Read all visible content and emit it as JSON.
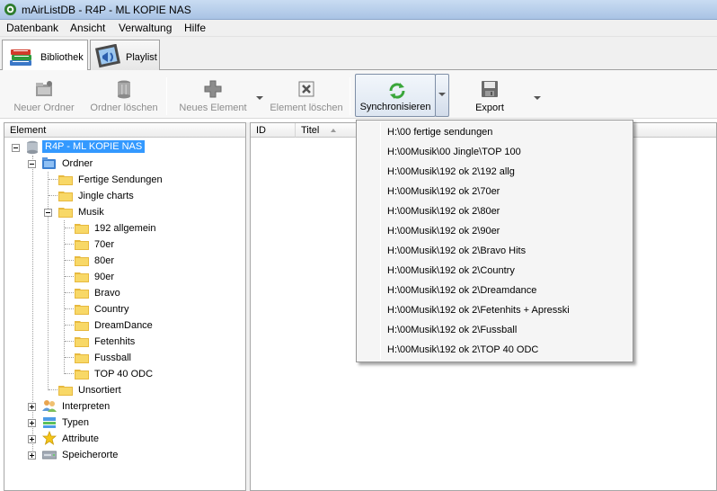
{
  "window": {
    "title": "mAirListDB - R4P - ML KOPIE NAS"
  },
  "menu": [
    "Datenbank",
    "Ansicht",
    "Verwaltung",
    "Hilfe"
  ],
  "tabs": [
    {
      "label": "Bibliothek",
      "active": true,
      "icon": "books-icon"
    },
    {
      "label": "Playlist",
      "active": false,
      "icon": "playlist-icon"
    }
  ],
  "toolbar": {
    "new_folder": "Neuer Ordner",
    "delete_folder": "Ordner löschen",
    "new_element": "Neues Element",
    "delete_element": "Element löschen",
    "sync": "Synchronisieren",
    "export": "Export"
  },
  "tree": {
    "header": "Element",
    "root": "R4P - ML KOPIE NAS",
    "ordner": "Ordner",
    "fertige": "Fertige Sendungen",
    "jingle": "Jingle charts",
    "musik": "Musik",
    "musik_children": [
      "192 allgemein",
      "70er",
      "80er",
      "90er",
      "Bravo",
      "Country",
      "DreamDance",
      "Fetenhits",
      "Fussball",
      "TOP 40 ODC"
    ],
    "unsortiert": "Unsortiert",
    "interpreten": "Interpreten",
    "typen": "Typen",
    "attribute": "Attribute",
    "speicherorte": "Speicherorte"
  },
  "list": {
    "columns": [
      "ID",
      "Titel"
    ]
  },
  "sync_menu": [
    "H:\\00 fertige sendungen",
    "H:\\00Musik\\00 Jingle\\TOP 100",
    "H:\\00Musik\\192 ok 2\\192 allg",
    "H:\\00Musik\\192 ok 2\\70er",
    "H:\\00Musik\\192 ok 2\\80er",
    "H:\\00Musik\\192 ok 2\\90er",
    "H:\\00Musik\\192 ok 2\\Bravo Hits",
    "H:\\00Musik\\192 ok 2\\Country",
    "H:\\00Musik\\192 ok 2\\Dreamdance",
    "H:\\00Musik\\192 ok 2\\Fetenhits + Apresski",
    "H:\\00Musik\\192 ok 2\\Fussball",
    "H:\\00Musik\\192 ok 2\\TOP 40 ODC"
  ],
  "colors": {
    "selection": "#3399ff",
    "folder": "#f2c94c",
    "sync_icon": "#3aa63a"
  }
}
